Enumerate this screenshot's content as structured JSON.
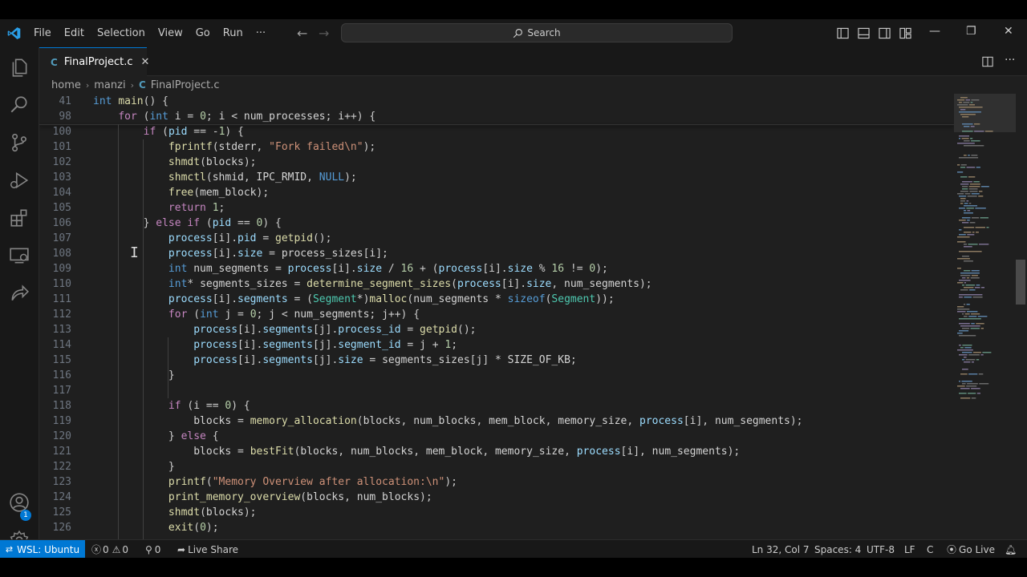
{
  "menu": [
    "File",
    "Edit",
    "Selection",
    "View",
    "Go",
    "Run",
    "···"
  ],
  "search": {
    "label": "Search"
  },
  "window_controls": {
    "minimize": "—",
    "restore": "❐",
    "close": "✕"
  },
  "tab": {
    "lang": "C",
    "label": "FinalProject.c",
    "close": "✕"
  },
  "breadcrumb": {
    "part1": "home",
    "part2": "manzi",
    "lang": "C",
    "file": "FinalProject.c",
    "sep": "›"
  },
  "sticky_lines": [
    {
      "num": "41",
      "code": "int main() {"
    },
    {
      "num": "98",
      "code": "    for (int i = 0; i < num_processes; i++) {"
    }
  ],
  "code_lines": [
    {
      "num": "100",
      "code": "        if (pid == -1) {"
    },
    {
      "num": "101",
      "code": "            fprintf(stderr, \"Fork failed\\n\");"
    },
    {
      "num": "102",
      "code": "            shmdt(blocks);"
    },
    {
      "num": "103",
      "code": "            shmctl(shmid, IPC_RMID, NULL);"
    },
    {
      "num": "104",
      "code": "            free(mem_block);"
    },
    {
      "num": "105",
      "code": "            return 1;"
    },
    {
      "num": "106",
      "code": "        } else if (pid == 0) {"
    },
    {
      "num": "107",
      "code": "            process[i].pid = getpid();"
    },
    {
      "num": "108",
      "code": "            process[i].size = process_sizes[i];"
    },
    {
      "num": "109",
      "code": "            int num_segments = process[i].size / 16 + (process[i].size % 16 != 0);"
    },
    {
      "num": "110",
      "code": "            int* segments_sizes = determine_segment_sizes(process[i].size, num_segments);"
    },
    {
      "num": "111",
      "code": "            process[i].segments = (Segment*)malloc(num_segments * sizeof(Segment));"
    },
    {
      "num": "112",
      "code": "            for (int j = 0; j < num_segments; j++) {"
    },
    {
      "num": "113",
      "code": "                process[i].segments[j].process_id = getpid();"
    },
    {
      "num": "114",
      "code": "                process[i].segments[j].segment_id = j + 1;"
    },
    {
      "num": "115",
      "code": "                process[i].segments[j].size = segments_sizes[j] * SIZE_OF_KB;"
    },
    {
      "num": "116",
      "code": "            }"
    },
    {
      "num": "117",
      "code": ""
    },
    {
      "num": "118",
      "code": "            if (i == 0) {"
    },
    {
      "num": "119",
      "code": "                blocks = memory_allocation(blocks, num_blocks, mem_block, memory_size, process[i], num_segments);"
    },
    {
      "num": "120",
      "code": "            } else {"
    },
    {
      "num": "121",
      "code": "                blocks = bestFit(blocks, num_blocks, mem_block, memory_size, process[i], num_segments);"
    },
    {
      "num": "122",
      "code": "            }"
    },
    {
      "num": "123",
      "code": "            printf(\"Memory Overview after allocation:\\n\");"
    },
    {
      "num": "124",
      "code": "            print_memory_overview(blocks, num_blocks);"
    },
    {
      "num": "125",
      "code": "            shmdt(blocks);"
    },
    {
      "num": "126",
      "code": "            exit(0);"
    }
  ],
  "accounts_badge": "1",
  "status": {
    "remote": "WSL: Ubuntu",
    "errors": "0",
    "warnings": "0",
    "ports": "0",
    "live_share": "Live Share",
    "position": "Ln 32, Col 7",
    "spaces": "Spaces: 4",
    "encoding": "UTF-8",
    "eol": "LF",
    "language": "C",
    "go_live": "Go Live"
  },
  "colors": {
    "accent": "#0078d4",
    "keyword": "#569cd6",
    "function": "#dcdcaa",
    "string": "#ce9178",
    "number": "#b5cea8",
    "variable": "#9cdcfe",
    "type": "#4ec9b0",
    "control": "#c586c0"
  }
}
